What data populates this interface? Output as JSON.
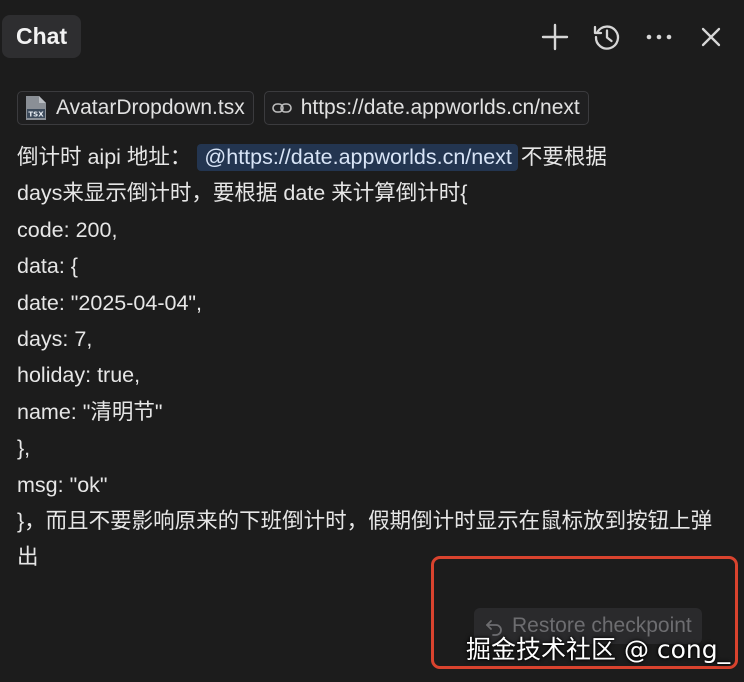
{
  "header": {
    "tab_label": "Chat",
    "actions": [
      {
        "name": "new-chat",
        "icon": "plus-icon"
      },
      {
        "name": "history",
        "icon": "history-icon"
      },
      {
        "name": "more",
        "icon": "ellipsis-icon"
      },
      {
        "name": "close",
        "icon": "close-icon"
      }
    ]
  },
  "context": {
    "file_chip": {
      "label": "AvatarDropdown.tsx",
      "icon": "tsx-file-icon"
    },
    "link_chip": {
      "label": "https://date.appworlds.cn/next",
      "icon": "link-icon"
    }
  },
  "message": {
    "line1_prefix": "倒计时 aipi 地址：",
    "mention": "@https://date.appworlds.cn/next",
    "line1_suffix": "不要根据",
    "lines": [
      "days来显示倒计时，要根据 date 来计算倒计时{",
      "code: 200,",
      "data: {",
      "date: \"2025-04-04\",",
      "days: 7,",
      "holiday: true,",
      "name: \"清明节\"",
      "},",
      "msg: \"ok\""
    ],
    "last_line": "}，而且不要影响原来的下班倒计时，假期倒计时显示在鼠标放到按钮上弹出"
  },
  "checkpoint": {
    "restore_label": "Restore checkpoint",
    "icon": "undo-icon"
  },
  "watermark": "掘金技术社区 @ cong_",
  "colors": {
    "background": "#1c1c1c",
    "mention_bg": "#233550",
    "highlight_border": "#d9432e"
  }
}
